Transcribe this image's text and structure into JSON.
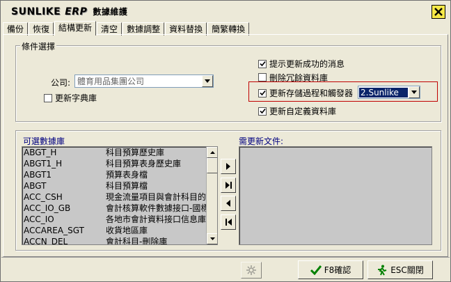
{
  "window": {
    "brand": "SUNLIKE",
    "brand_erp": "ERP",
    "subtitle": "數據維護"
  },
  "tabs": [
    {
      "label": "備份"
    },
    {
      "label": "恢復"
    },
    {
      "label": "結構更新"
    },
    {
      "label": "清空"
    },
    {
      "label": "數據調整"
    },
    {
      "label": "資料替換"
    },
    {
      "label": "簡繁轉換"
    }
  ],
  "conditions": {
    "group_label": "條件選擇",
    "company_label": "公司:",
    "company_value": "體育用品集團公司",
    "update_dictionary": "更新字典庫",
    "show_success_msg": "提示更新成功的消息",
    "delete_redundant": "刪除冗餘資料庫",
    "update_procedures": "更新存儲過程和觸發器",
    "procedure_option": "2.Sunlike",
    "update_custom_db": "更新自定義資料庫"
  },
  "lists": {
    "available_label": "可選數據庫",
    "update_label": "需更新文件:",
    "databases": [
      {
        "code": "ABGT_H",
        "desc": "科目預算歷史庫"
      },
      {
        "code": "ABGT1_H",
        "desc": "科目預算表身歷史庫"
      },
      {
        "code": "ABGT1",
        "desc": "預算表身檔"
      },
      {
        "code": "ABGT",
        "desc": "科目預算檔"
      },
      {
        "code": "ACC_CSH",
        "desc": "現金流量項目與會計科目的"
      },
      {
        "code": "ACC_IO_GB",
        "desc": "會計核算軟件數據接口-國標"
      },
      {
        "code": "ACC_IO",
        "desc": "各地市會計資料接口信息庫"
      },
      {
        "code": "ACCAREA_SGT",
        "desc": "收貨地區庫"
      },
      {
        "code": "ACCN_DEL",
        "desc": "會計科目-刪除庫"
      }
    ]
  },
  "footer": {
    "confirm": "F8確認",
    "close": "ESC關閉"
  },
  "colors": {
    "accent_red": "#c00000",
    "selected_bg": "#0a246a"
  }
}
